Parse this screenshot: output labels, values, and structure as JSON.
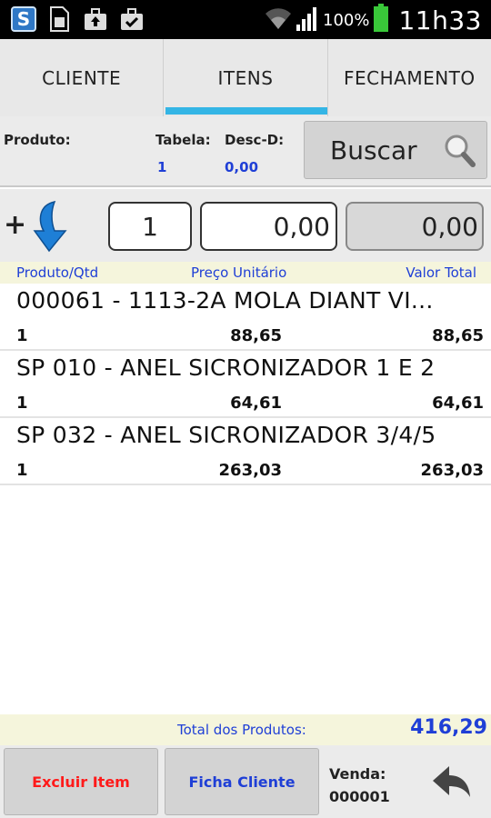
{
  "status_bar": {
    "battery_percent": "100%",
    "time": "11h33",
    "app_icon_letter": "S",
    "icons": [
      "app-icon",
      "sim-card-icon",
      "briefcase-upload-icon",
      "briefcase-check-icon",
      "wifi-icon",
      "signal-icon",
      "battery-icon"
    ]
  },
  "tabs": [
    {
      "label": "CLIENTE",
      "active": false
    },
    {
      "label": "ITENS",
      "active": true
    },
    {
      "label": "FECHAMENTO",
      "active": false
    }
  ],
  "product": {
    "produto_label": "Produto:",
    "tabela_label": "Tabela:",
    "tabela_value": "1",
    "desc_label": "Desc-D:",
    "desc_value": "0,00",
    "buscar_label": "Buscar"
  },
  "entry": {
    "plus": "+",
    "quantity": "1",
    "unit_price": "0,00",
    "total": "0,00"
  },
  "columns": {
    "produto_qtd": "Produto/Qtd",
    "preco_unitario": "Preço Unitário",
    "valor_total": "Valor Total"
  },
  "items": [
    {
      "name": "000061 - 1113-2A MOLA DIANT VI...",
      "qty": "1",
      "price": "88,65",
      "total": "88,65"
    },
    {
      "name": "SP 010 - ANEL SICRONIZADOR 1 E 2",
      "qty": "1",
      "price": "64,61",
      "total": "64,61"
    },
    {
      "name": "SP 032 - ANEL SICRONIZADOR 3/4/5",
      "qty": "1",
      "price": "263,03",
      "total": "263,03"
    }
  ],
  "totals": {
    "label": "Total dos Produtos:",
    "value": "416,29"
  },
  "bottom": {
    "excluir_label": "Excluir Item",
    "ficha_label": "Ficha Cliente",
    "venda_label": "Venda:",
    "venda_number": "000001"
  },
  "colors": {
    "accent_tab": "#34b5e5",
    "value_blue": "#1f3fd6",
    "delete_red": "#ff1a1a",
    "header_beige": "#f5f5dc"
  }
}
